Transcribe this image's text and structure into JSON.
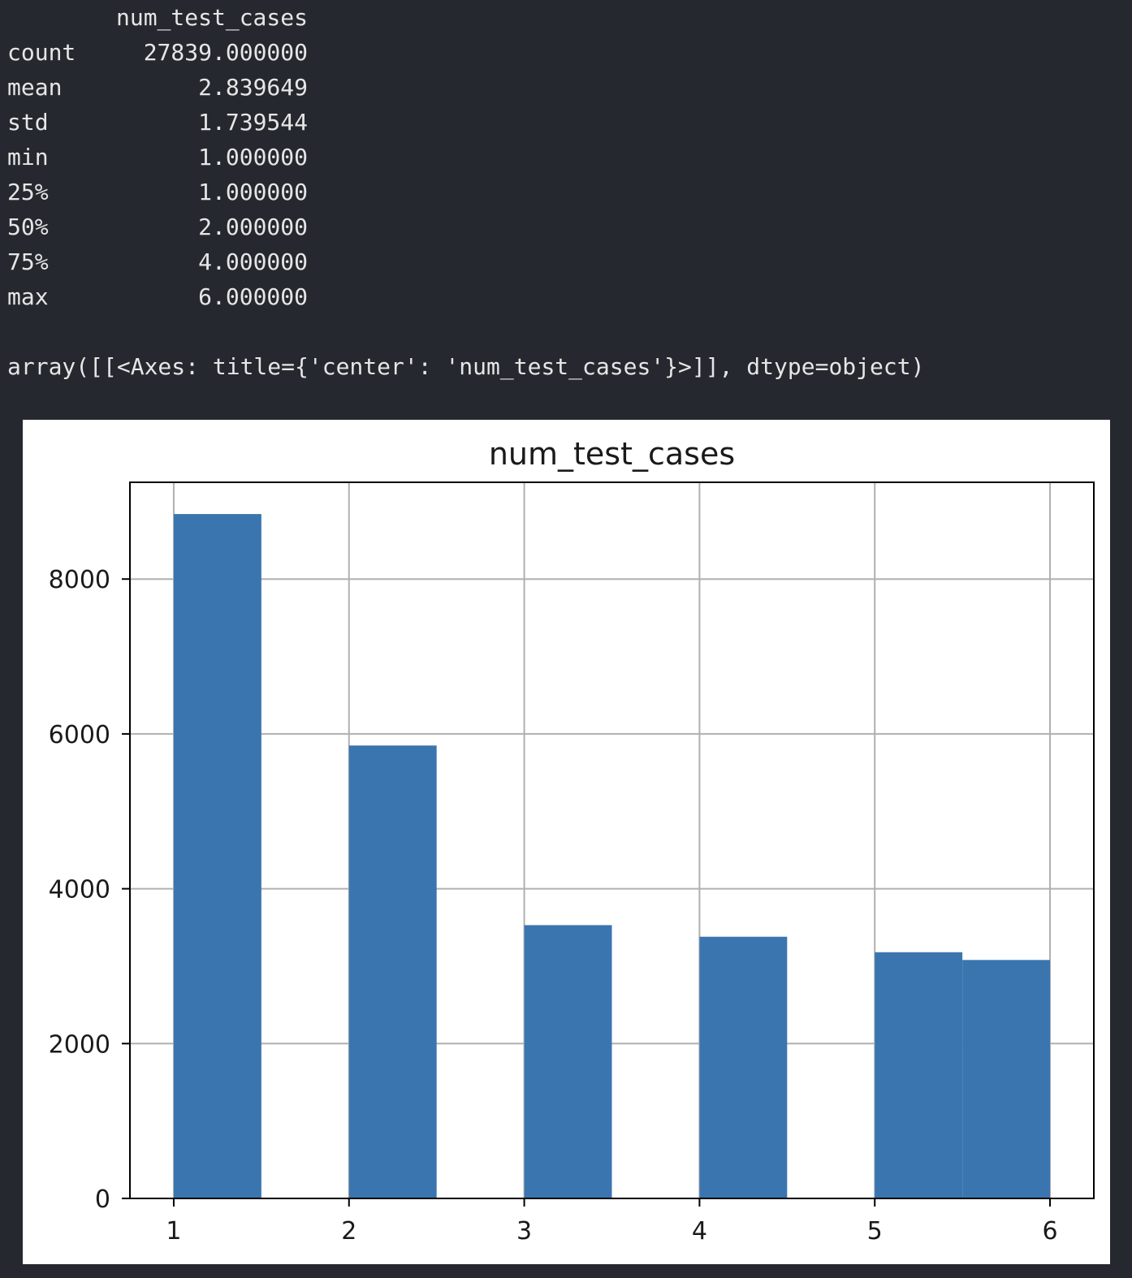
{
  "describe": {
    "column_header": "num_test_cases",
    "rows": [
      {
        "label": "count",
        "value": "27839.000000"
      },
      {
        "label": "mean",
        "value": "2.839649"
      },
      {
        "label": "std",
        "value": "1.739544"
      },
      {
        "label": "min",
        "value": "1.000000"
      },
      {
        "label": "25%",
        "value": "1.000000"
      },
      {
        "label": "50%",
        "value": "2.000000"
      },
      {
        "label": "75%",
        "value": "4.000000"
      },
      {
        "label": "max",
        "value": "6.000000"
      }
    ]
  },
  "repr_output": "array([[<Axes: title={'center': 'num_test_cases'}>]], dtype=object)",
  "colors": {
    "background": "#25282e",
    "bar": "#3a75af",
    "grid": "#b0b0b0",
    "figure": "#ffffff"
  },
  "chart_data": {
    "type": "bar",
    "title": "num_test_cases",
    "xlabel": "",
    "ylabel": "",
    "bins": [
      {
        "x0": 1.0,
        "x1": 1.5,
        "count": 8840
      },
      {
        "x0": 1.5,
        "x1": 2.0,
        "count": 0
      },
      {
        "x0": 2.0,
        "x1": 2.5,
        "count": 5850
      },
      {
        "x0": 2.5,
        "x1": 3.0,
        "count": 0
      },
      {
        "x0": 3.0,
        "x1": 3.5,
        "count": 3530
      },
      {
        "x0": 3.5,
        "x1": 4.0,
        "count": 0
      },
      {
        "x0": 4.0,
        "x1": 4.5,
        "count": 3380
      },
      {
        "x0": 4.5,
        "x1": 5.0,
        "count": 0
      },
      {
        "x0": 5.0,
        "x1": 5.5,
        "count": 3180
      },
      {
        "x0": 5.5,
        "x1": 6.0,
        "count": 3080
      }
    ],
    "xlim": [
      0.75,
      6.25
    ],
    "ylim": [
      0,
      9250
    ],
    "xticks": [
      1,
      2,
      3,
      4,
      5,
      6
    ],
    "yticks": [
      0,
      2000,
      4000,
      6000,
      8000
    ],
    "grid": true,
    "legend": "none"
  }
}
